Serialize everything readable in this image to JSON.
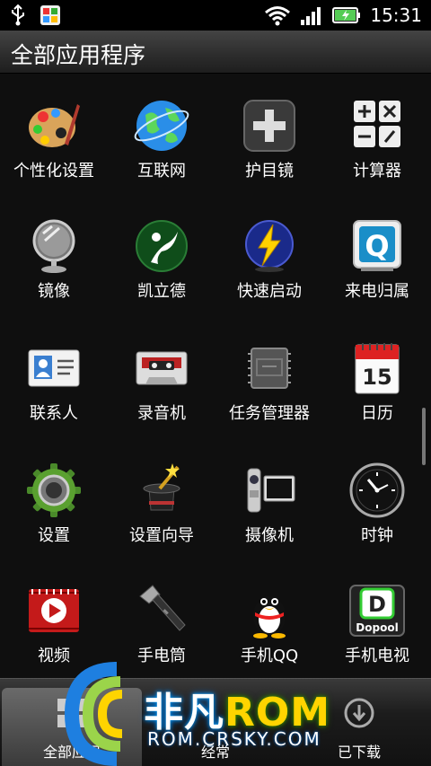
{
  "status_bar": {
    "time": "15:31",
    "icons": [
      "usb-icon",
      "notification-app-icon",
      "wifi-icon",
      "signal-icon",
      "battery-charging-icon"
    ]
  },
  "header": {
    "title": "全部应用程序"
  },
  "apps": [
    {
      "label": "个性化设置",
      "icon": "palette-icon"
    },
    {
      "label": "互联网",
      "icon": "globe-icon"
    },
    {
      "label": "护目镜",
      "icon": "plus-icon"
    },
    {
      "label": "计算器",
      "icon": "calculator-icon"
    },
    {
      "label": "镜像",
      "icon": "mirror-icon"
    },
    {
      "label": "凯立德",
      "icon": "kailide-icon"
    },
    {
      "label": "快速启动",
      "icon": "lightning-icon"
    },
    {
      "label": "来电归属",
      "icon": "q-icon"
    },
    {
      "label": "联系人",
      "icon": "contacts-icon"
    },
    {
      "label": "录音机",
      "icon": "cassette-icon"
    },
    {
      "label": "任务管理器",
      "icon": "chip-icon"
    },
    {
      "label": "日历",
      "icon": "calendar-icon"
    },
    {
      "label": "设置",
      "icon": "gear-icon"
    },
    {
      "label": "设置向导",
      "icon": "magic-hat-icon"
    },
    {
      "label": "摄像机",
      "icon": "camcorder-icon"
    },
    {
      "label": "时钟",
      "icon": "clock-icon"
    },
    {
      "label": "视频",
      "icon": "video-icon"
    },
    {
      "label": "手电筒",
      "icon": "flashlight-icon"
    },
    {
      "label": "手机QQ",
      "icon": "penguin-icon"
    },
    {
      "label": "手机电视",
      "icon": "dopool-icon"
    }
  ],
  "calendar_day": "15",
  "dopool_text": "Dopool",
  "bottom_tabs": [
    {
      "label": "全部应用",
      "active": true
    },
    {
      "label": "经常",
      "active": false
    },
    {
      "label": "已下载",
      "active": false
    }
  ],
  "watermark": {
    "cn": "非凡",
    "rom": "ROM",
    "url": "ROM.CRSKY.COM"
  }
}
